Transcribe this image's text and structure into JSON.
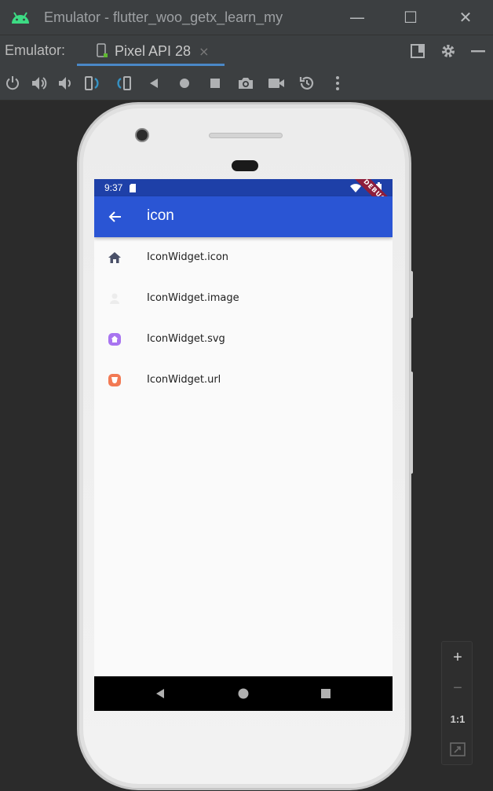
{
  "window": {
    "title": "Emulator - flutter_woo_getx_learn_my",
    "minimize_symbol": "—",
    "maximize_symbol": "☐",
    "close_symbol": "✕"
  },
  "tabbar": {
    "label": "Emulator:",
    "tab_title": "Pixel API 28",
    "tab_close": "×"
  },
  "toolbar": {
    "icons": [
      "power-icon",
      "volume-up-icon",
      "volume-down-icon",
      "rotate-left-icon",
      "rotate-right-icon",
      "back-icon",
      "home-icon",
      "overview-icon",
      "screenshot-icon",
      "screen-record-icon",
      "snapshot-icon",
      "more-icon"
    ]
  },
  "device": {
    "status_time": "9:37",
    "debug_label": "DEBUG",
    "appbar_title": "icon",
    "accent": "#2a55d4",
    "status_color": "#1e40a8",
    "list": [
      {
        "label": "IconWidget.icon",
        "icon": "home-icon"
      },
      {
        "label": "IconWidget.image",
        "icon": "image-icon"
      },
      {
        "label": "IconWidget.svg",
        "icon": "svg-home-icon"
      },
      {
        "label": "IconWidget.url",
        "icon": "url-image-icon"
      }
    ]
  },
  "zoom": {
    "zoom_in": "+",
    "zoom_out": "−",
    "actual_size": "1:1",
    "fit": "fit-screen-icon"
  }
}
